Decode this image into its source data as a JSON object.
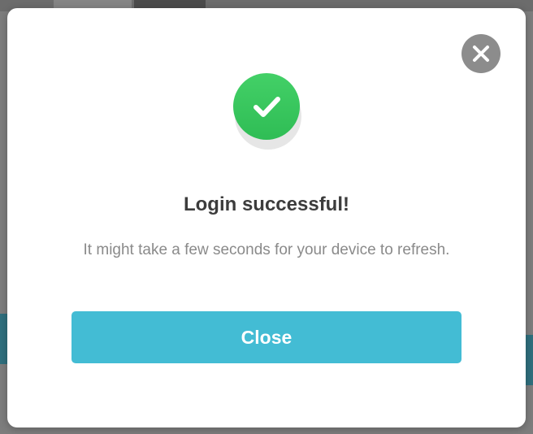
{
  "dialog": {
    "title": "Login successful!",
    "message": "It might take a few seconds for your device to refresh.",
    "close_button_label": "Close",
    "status_icon": "check-circle-icon",
    "dismiss_icon": "close-icon"
  },
  "colors": {
    "accent": "#43bcd4",
    "success": "#35c45b",
    "dismiss": "#8c8c8c",
    "overlay": "#7d7d7d"
  }
}
